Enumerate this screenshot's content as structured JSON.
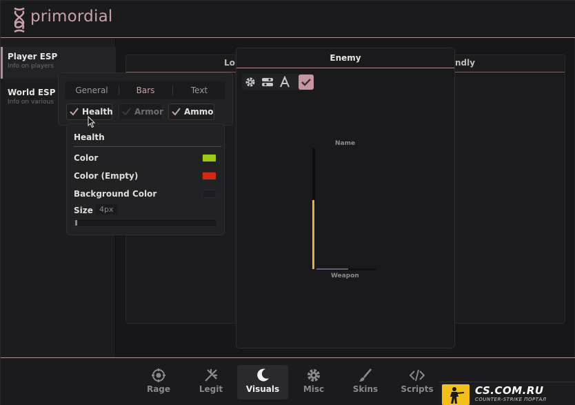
{
  "header": {
    "brand": "primordial"
  },
  "sidebar": {
    "items": [
      {
        "title": "Player ESP",
        "subtitle": "Info on players",
        "active": true
      },
      {
        "title": "World ESP",
        "subtitle": "Info on various",
        "active": false
      }
    ]
  },
  "background_tabs": {
    "left": "Lo",
    "right": "ndly"
  },
  "enemy_panel": {
    "title": "Enemy",
    "toolbar_icons": [
      "gear-icon",
      "toggles-icon",
      "text-icon",
      "check-icon"
    ],
    "preview": {
      "name_label": "Name",
      "weapon_label": "Weapon",
      "health_fraction": 0.57,
      "weapon_fraction": 0.53
    }
  },
  "tabs_popup": {
    "tabs": [
      "General",
      "Bars",
      "Text"
    ],
    "active_tab": "Bars",
    "checkboxes": [
      {
        "label": "Health",
        "checked": true
      },
      {
        "label": "Armor",
        "checked": false
      },
      {
        "label": "Ammo",
        "checked": true
      }
    ]
  },
  "health_settings": {
    "title": "Health",
    "rows": [
      {
        "label": "Color",
        "color": "#9ccc12"
      },
      {
        "label": "Color (Empty)",
        "color": "#d42a14"
      },
      {
        "label": "Background Color",
        "color": "#1e1e21"
      }
    ],
    "size_label": "Size",
    "size_value": "4px",
    "size_fraction": 0.0
  },
  "bottom_nav": {
    "items": [
      {
        "label": "Rage",
        "icon": "target-icon",
        "active": false
      },
      {
        "label": "Legit",
        "icon": "crosshair-icon",
        "active": false
      },
      {
        "label": "Visuals",
        "icon": "moon-icon",
        "active": true
      },
      {
        "label": "Misc",
        "icon": "gear-icon",
        "active": false
      },
      {
        "label": "Skins",
        "icon": "brush-icon",
        "active": false
      },
      {
        "label": "Scripts",
        "icon": "code-icon",
        "active": false
      }
    ]
  },
  "watermark": {
    "text": "CS.COM.RU",
    "subtext": "COUNTER-STRIKE ПОРТАЛ"
  },
  "colors": {
    "accent": "#b98d96",
    "accent_light": "#c9a1aa",
    "health_bar": "#e8b23a"
  }
}
